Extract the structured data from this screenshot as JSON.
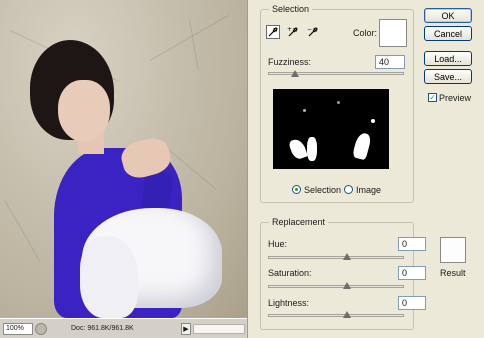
{
  "selection": {
    "group_label": "Selection",
    "color_label": "Color:",
    "fuzziness_label": "Fuzziness:",
    "fuzziness_value": "40",
    "fuzziness_level": 0.2,
    "mode_selection_label": "Selection",
    "mode_image_label": "Image",
    "eyedroppers": [
      "eyedropper-icon",
      "eyedropper-plus-icon",
      "eyedropper-minus-icon"
    ]
  },
  "buttons": {
    "ok": "OK",
    "cancel": "Cancel",
    "load": "Load...",
    "save": "Save...",
    "preview": "Preview"
  },
  "replacement": {
    "group_label": "Replacement",
    "hue_label": "Hue:",
    "hue_value": "0",
    "saturation_label": "Saturation:",
    "saturation_value": "0",
    "lightness_label": "Lightness:",
    "lightness_value": "0",
    "result_label": "Result"
  },
  "status": {
    "zoom": "100%",
    "doc": "Doc: 961.8K/961.8K",
    "arrow": "▶"
  },
  "colors": {
    "dialog_bg": "#ece9d8",
    "button_border": "#003c74",
    "sweater": "#3b22c2"
  }
}
